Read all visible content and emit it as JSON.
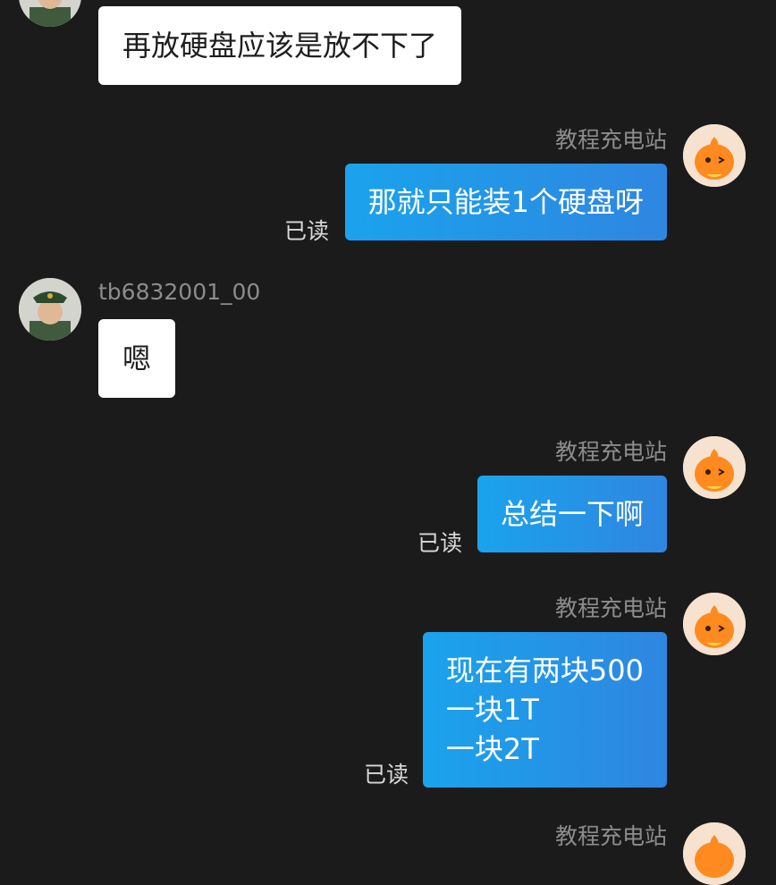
{
  "messages": [
    {
      "id": "m1",
      "direction": "in",
      "text": "再放硬盘应该是放不下了"
    },
    {
      "id": "m2",
      "direction": "out",
      "sender": "教程充电站",
      "text": "那就只能装1个硬盘呀",
      "status": "已读"
    },
    {
      "id": "m3",
      "direction": "in",
      "sender": "tb6832001_00",
      "text": "嗯"
    },
    {
      "id": "m4",
      "direction": "out",
      "sender": "教程充电站",
      "text": "总结一下啊",
      "status": "已读"
    },
    {
      "id": "m5",
      "direction": "out",
      "sender": "教程充电站",
      "lines": [
        "现在有两块500",
        "一块1T",
        "一块2T"
      ],
      "status": "已读"
    }
  ],
  "next_sender": "教程充电站",
  "colors": {
    "background": "#1b1b1b",
    "outgoing_bubble": "#1aa3ec",
    "incoming_bubble": "#ffffff",
    "nickname": "#8c8c8c"
  },
  "icons": {
    "user_avatar": "soldier-avatar-icon",
    "shop_avatar": "orange-mascot-avatar-icon"
  }
}
